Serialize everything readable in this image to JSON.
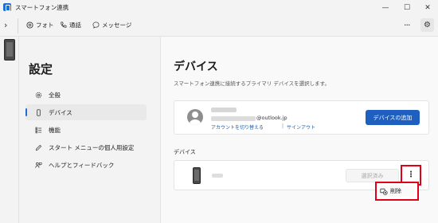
{
  "window": {
    "title": "スマートフォン連携"
  },
  "toolbar": {
    "tabs": [
      {
        "label": "フォト",
        "icon": "photo-icon"
      },
      {
        "label": "通話",
        "icon": "phone-call-icon"
      },
      {
        "label": "メッセージ",
        "icon": "message-icon"
      }
    ]
  },
  "nav": {
    "title": "設定",
    "items": [
      {
        "label": "全般",
        "icon": "gear-icon",
        "active": false
      },
      {
        "label": "デバイス",
        "icon": "device-icon",
        "active": true
      },
      {
        "label": "機能",
        "icon": "features-icon",
        "active": false
      },
      {
        "label": "スタート メニューの個人用設定",
        "icon": "pen-icon",
        "active": false
      },
      {
        "label": "ヘルプとフィードバック",
        "icon": "help-icon",
        "active": false
      }
    ]
  },
  "main": {
    "title": "デバイス",
    "description": "スマートフォン連携に接続するプライマリ デバイスを選択します。",
    "account": {
      "email_domain": "@outlook.jp",
      "switch_link": "アカウントを切り替える",
      "separator": "|",
      "signout_link": "サインアウト",
      "add_device_label": "デバイスの追加"
    },
    "devices_section_label": "デバイス",
    "device": {
      "selected_label": "選択済み",
      "more_glyph": "⋮"
    },
    "context_menu": {
      "delete_label": "削除"
    }
  },
  "colors": {
    "accent": "#1f5fbf",
    "highlight": "#e0001a"
  }
}
